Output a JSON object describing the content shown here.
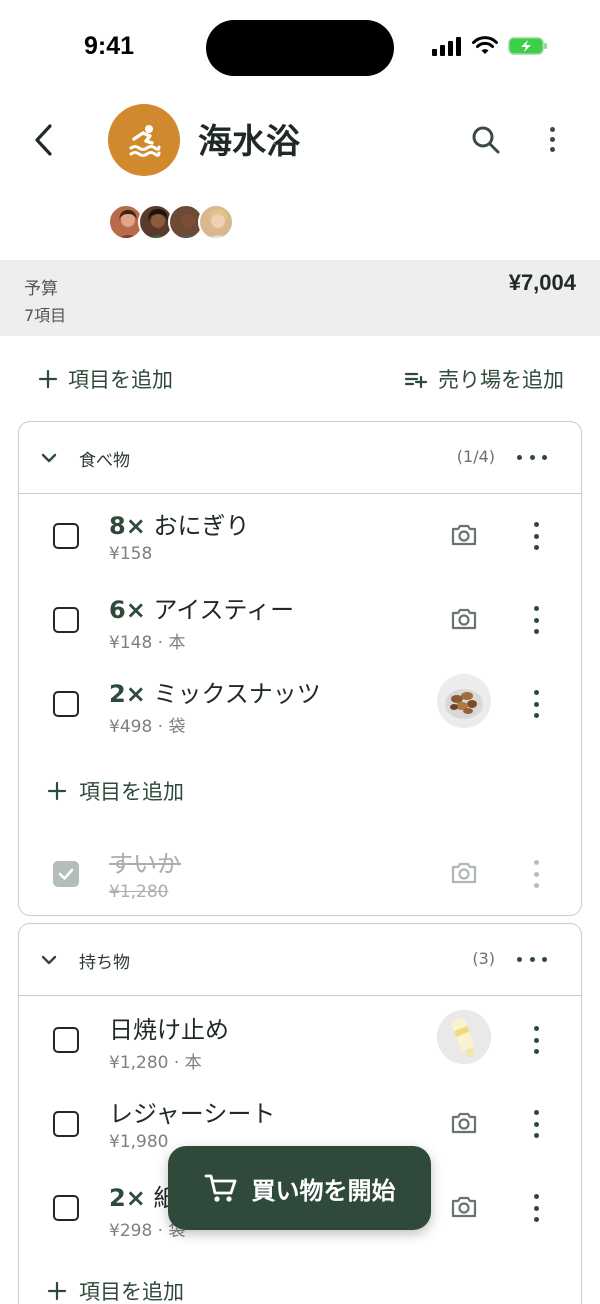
{
  "status_bar": {
    "time": "9:41"
  },
  "header": {
    "title": "海水浴",
    "icon": "swimmer-icon",
    "accent_color": "#d08a2d"
  },
  "members": [
    {
      "name": "member-1",
      "color": "#b86a4a"
    },
    {
      "name": "member-2",
      "color": "#5a3a2a"
    },
    {
      "name": "member-3",
      "color": "#6d4a36"
    },
    {
      "name": "member-4",
      "color": "#d9b88f"
    }
  ],
  "budget": {
    "label": "予算",
    "count": "7項目",
    "total": "¥7,004"
  },
  "actions": {
    "add_item": "項目を追加",
    "add_section": "売り場を追加"
  },
  "sections": [
    {
      "title": "食べ物",
      "count": "(1/4)",
      "items": [
        {
          "qty": "8×",
          "name": "おにぎり",
          "price": "¥158",
          "media": "camera-icon",
          "done": false
        },
        {
          "qty": "6×",
          "name": "アイスティー",
          "price": "¥148 · 本",
          "media": "camera-icon",
          "done": false
        },
        {
          "qty": "2×",
          "name": "ミックスナッツ",
          "price": "¥498 · 袋",
          "media": "nuts-photo",
          "done": false
        },
        {
          "qty": "",
          "name": "すいか",
          "price": "¥1,280",
          "media": "camera-icon",
          "done": true
        }
      ],
      "add_label": "項目を追加"
    },
    {
      "title": "持ち物",
      "count": "(3)",
      "items": [
        {
          "qty": "",
          "name": "日焼け止め",
          "price": "¥1,280 · 本",
          "media": "sunscreen-photo",
          "done": false
        },
        {
          "qty": "",
          "name": "レジャーシート",
          "price": "¥1,980",
          "media": "camera-icon",
          "done": false
        },
        {
          "qty": "2×",
          "name": "紙",
          "price": "¥298 · 袋",
          "media": "camera-icon",
          "done": false
        }
      ],
      "add_label": "項目を追加"
    }
  ],
  "fab": {
    "label": "買い物を開始",
    "icon": "cart-icon"
  },
  "colors": {
    "primary": "#2f4a3b",
    "battery": "#3ecf4a"
  }
}
